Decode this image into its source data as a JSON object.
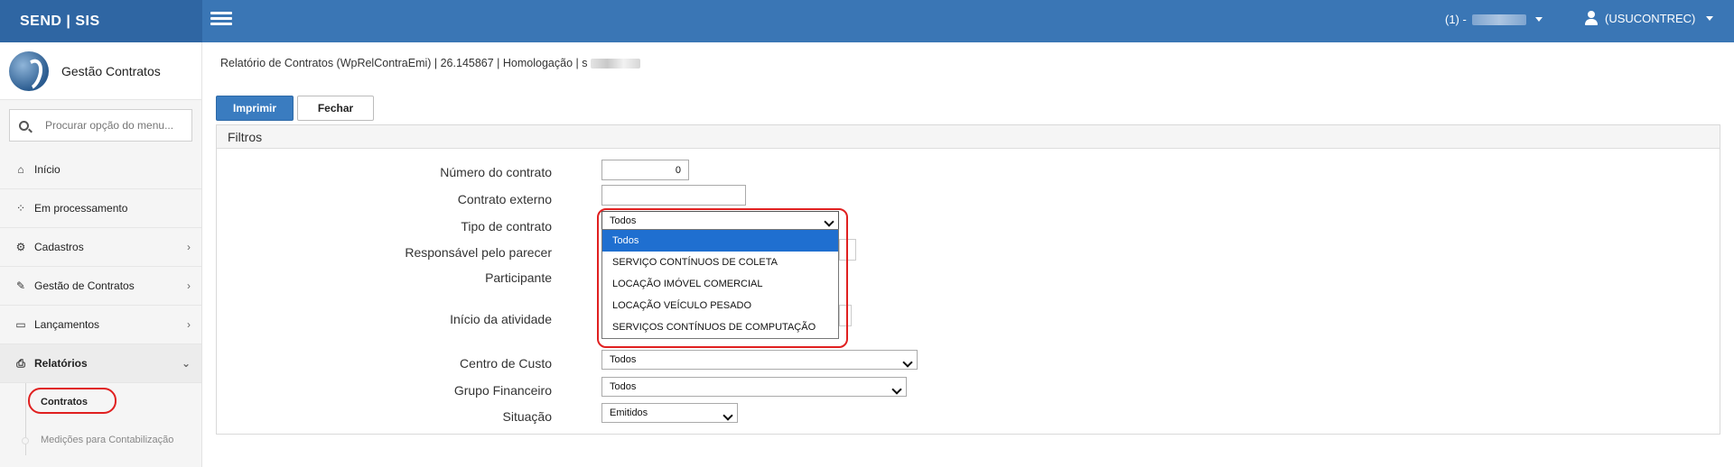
{
  "app": {
    "brand": "SEND | SIS",
    "module": "Gestão Contratos"
  },
  "topbar": {
    "session_label": "(1) -",
    "user_label": "(USUCONTREC)"
  },
  "search": {
    "placeholder": "Procurar opção do menu..."
  },
  "sidebar": {
    "items": [
      {
        "label": "Início",
        "icon": "home-icon"
      },
      {
        "label": "Em processamento",
        "icon": "spinner-icon"
      },
      {
        "label": "Cadastros",
        "icon": "gears-icon"
      },
      {
        "label": "Gestão de Contratos",
        "icon": "edit-icon"
      },
      {
        "label": "Lançamentos",
        "icon": "laptop-icon"
      },
      {
        "label": "Relatórios",
        "icon": "print-icon"
      }
    ],
    "subitems": [
      {
        "label": "Contratos"
      },
      {
        "label": "Medições para Contabilização"
      }
    ]
  },
  "page": {
    "breadcrumb": "Relatório de Contratos (WpRelContraEmi) | 26.145867 | Homologação | s",
    "print_button": "Imprimir",
    "close_button": "Fechar",
    "panel_title": "Filtros"
  },
  "filters": {
    "numero_contrato": {
      "label": "Número do contrato",
      "value": "0"
    },
    "contrato_externo": {
      "label": "Contrato externo",
      "value": ""
    },
    "tipo_contrato": {
      "label": "Tipo de contrato",
      "value": "Todos"
    },
    "responsavel": {
      "label": "Responsável pelo parecer"
    },
    "participante": {
      "label": "Participante"
    },
    "inicio_atividade": {
      "label": "Início da atividade"
    },
    "centro_custo": {
      "label": "Centro de Custo",
      "value": "Todos"
    },
    "grupo_financeiro": {
      "label": "Grupo Financeiro",
      "value": "Todos"
    },
    "situacao": {
      "label": "Situação",
      "value": "Emitidos"
    }
  },
  "dropdown_options": [
    "Todos",
    "SERVIÇO CONTÍNUOS DE COLETA",
    "LOCAÇÃO IMÓVEL COMERCIAL",
    "LOCAÇÃO VEÍCULO PESADO",
    "SERVIÇOS CONTÍNUOS DE COMPUTAÇÃO"
  ],
  "colors": {
    "topbar": "#3a76b5",
    "brand_bg": "#2f66a3",
    "primary": "#3a7cc0",
    "highlight": "#e02020",
    "option_selected": "#1f6fd0"
  }
}
